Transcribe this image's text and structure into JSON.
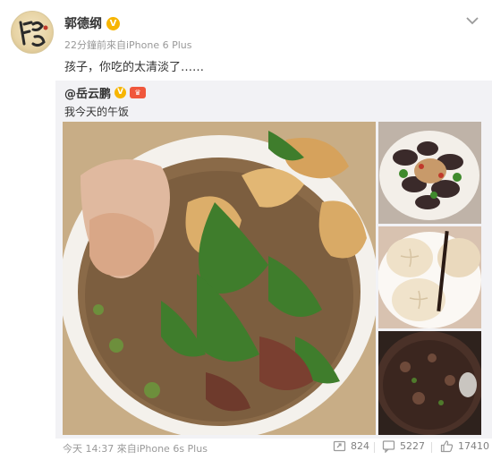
{
  "post": {
    "author": "郭德纲",
    "verified_badge": "V",
    "meta": "22分鐘前來自iPhone 6 Plus",
    "text": "孩子，你吃的太清淡了……"
  },
  "repost": {
    "author": "@岳云鹏",
    "verified_badge": "V",
    "text": "我今天的午饭"
  },
  "footer": {
    "time_source": "今天 14:37 來自iPhone 6s Plus",
    "repost_count": "824",
    "comment_count": "5227",
    "like_count": "17410"
  },
  "icons": {
    "menu": "chevron-down-icon",
    "repost": "repost-icon",
    "comment": "comment-icon",
    "like": "thumbs-up-icon"
  },
  "colors": {
    "badge": "#f7b500",
    "repost_bg": "#f2f2f5",
    "meta_text": "#999999"
  }
}
